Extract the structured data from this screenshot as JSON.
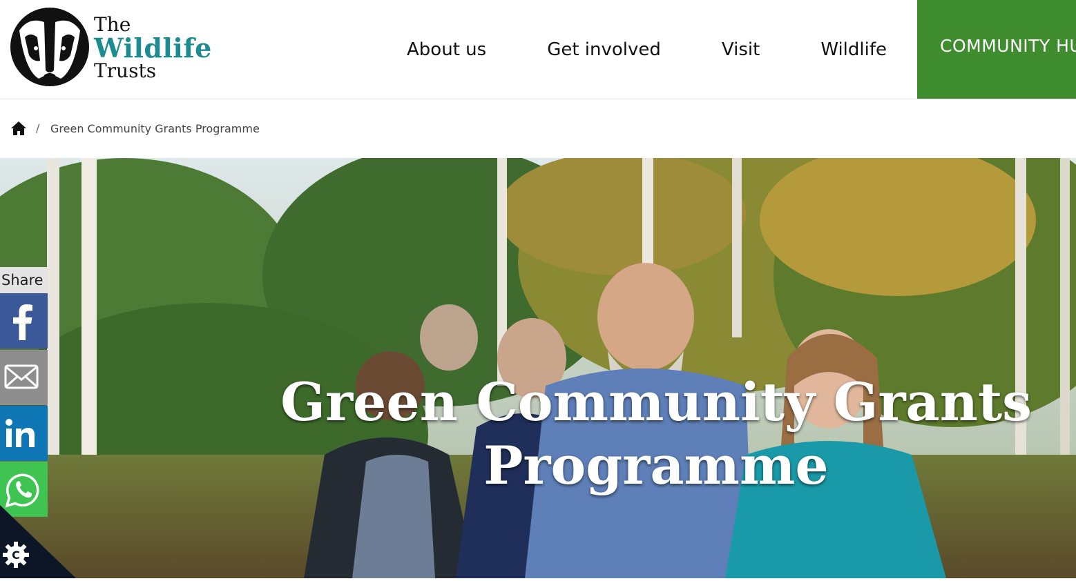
{
  "brand": {
    "line1": "The",
    "line2": "Wildlife",
    "line3": "Trusts",
    "accent_color": "#1d8b8f"
  },
  "nav": {
    "items": [
      {
        "label": "About us"
      },
      {
        "label": "Get involved"
      },
      {
        "label": "Visit"
      },
      {
        "label": "Wildlife"
      }
    ],
    "hub_label": "COMMUNITY HUB",
    "hub_color": "#3f8c2f"
  },
  "breadcrumb": {
    "home_icon": "home-icon",
    "separator": "/",
    "current": "Green Community Grants Programme"
  },
  "hero": {
    "title_line1": "Green Community Grants",
    "title_line2": "Programme"
  },
  "share": {
    "label": "Share",
    "buttons": [
      {
        "icon": "facebook-icon",
        "color": "#3b5998"
      },
      {
        "icon": "mail-icon",
        "color": "#8e8e8e"
      },
      {
        "icon": "linkedin-icon",
        "color": "#0e76b4"
      },
      {
        "icon": "whatsapp-icon",
        "color": "#3fc452"
      }
    ]
  },
  "cookie": {
    "icon": "cookie-settings-icon"
  }
}
